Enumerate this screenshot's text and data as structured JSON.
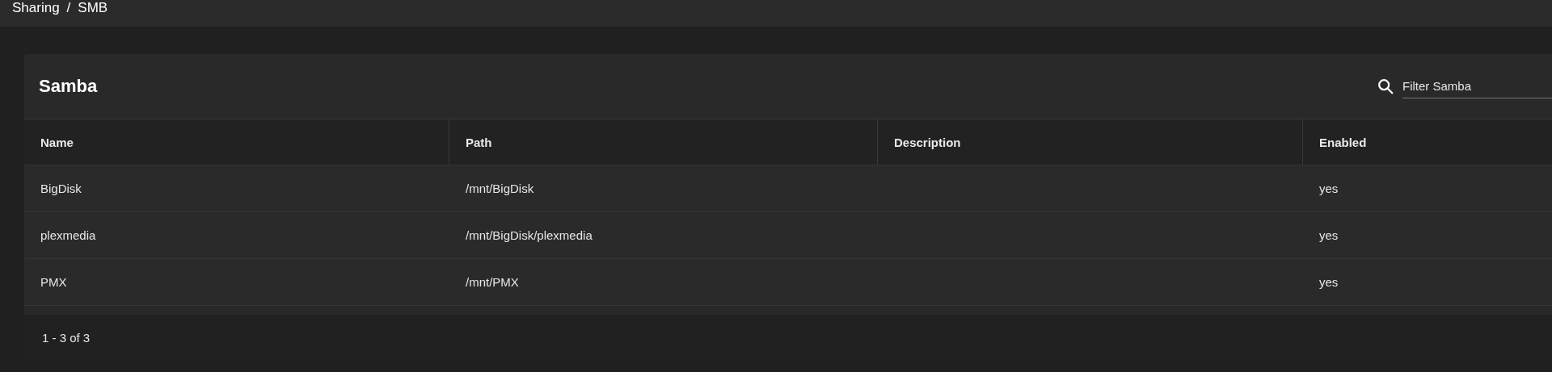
{
  "breadcrumb": [
    "Sharing",
    "/",
    "SMB"
  ],
  "card": {
    "title": "Samba",
    "search": {
      "placeholder": "Filter Samba"
    }
  },
  "table": {
    "columns": [
      "Name",
      "Path",
      "Description",
      "Enabled"
    ],
    "rows": [
      {
        "name": "BigDisk",
        "path": "/mnt/BigDisk",
        "description": "",
        "enabled": "yes"
      },
      {
        "name": "plexmedia",
        "path": "/mnt/BigDisk/plexmedia",
        "description": "",
        "enabled": "yes"
      },
      {
        "name": "PMX",
        "path": "/mnt/PMX",
        "description": "",
        "enabled": "yes"
      }
    ]
  },
  "paginator": "1 - 3 of 3"
}
